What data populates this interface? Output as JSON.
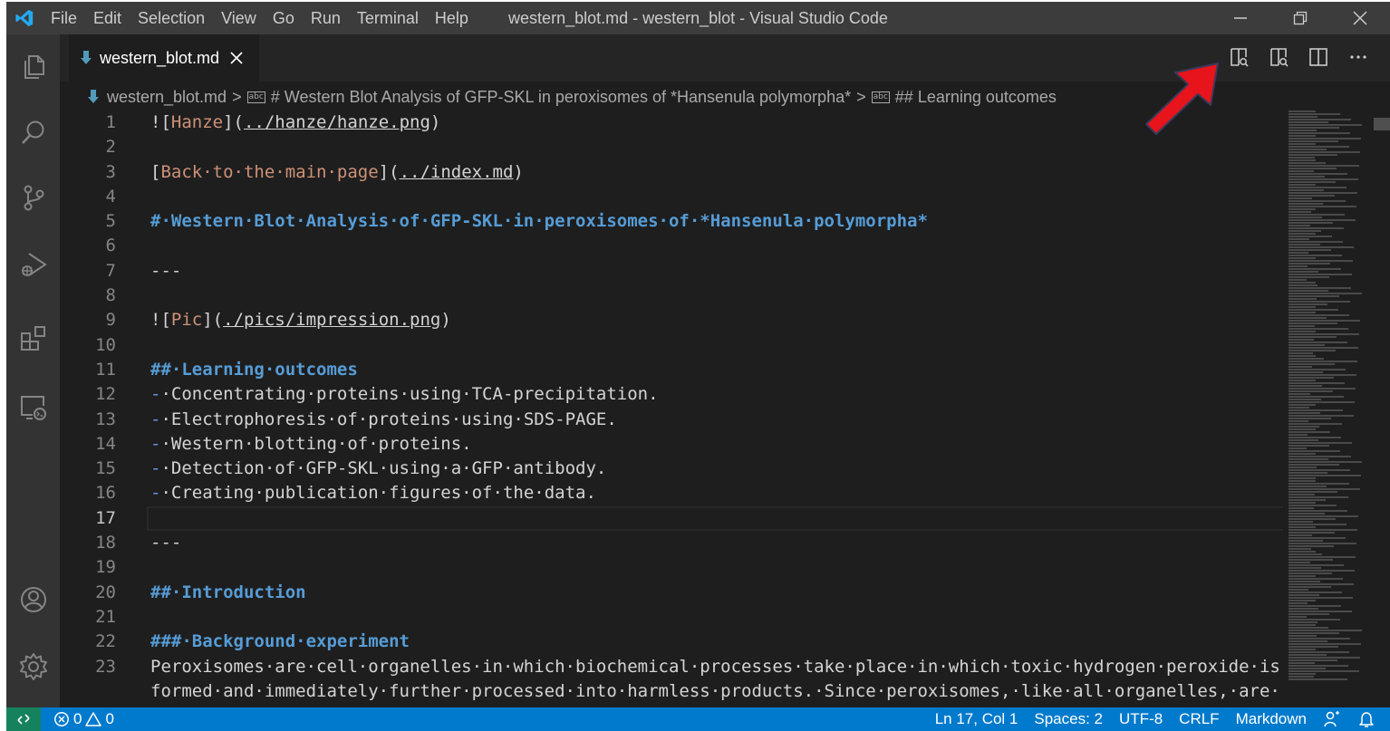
{
  "window": {
    "title": "western_blot.md - western_blot - Visual Studio Code",
    "menu": [
      "File",
      "Edit",
      "Selection",
      "View",
      "Go",
      "Run",
      "Terminal",
      "Help"
    ]
  },
  "tab": {
    "label": "western_blot.md"
  },
  "breadcrumb": {
    "file": "western_blot.md",
    "section1": "# Western Blot Analysis of GFP-SKL in peroxisomes of *Hansenula polymorpha*",
    "section2": "## Learning outcomes"
  },
  "lines": [
    {
      "n": "1",
      "segs": [
        {
          "c": "t",
          "v": "!["
        },
        {
          "c": "lnk",
          "v": "Hanze"
        },
        {
          "c": "t",
          "v": "]("
        },
        {
          "c": "url",
          "v": "../hanze/hanze.png"
        },
        {
          "c": "t",
          "v": ")"
        }
      ]
    },
    {
      "n": "2",
      "segs": []
    },
    {
      "n": "3",
      "segs": [
        {
          "c": "t",
          "v": "["
        },
        {
          "c": "lnk",
          "v": "Back·to·the·main·page"
        },
        {
          "c": "t",
          "v": "]("
        },
        {
          "c": "url",
          "v": "../index.md"
        },
        {
          "c": "t",
          "v": ")"
        }
      ]
    },
    {
      "n": "4",
      "segs": []
    },
    {
      "n": "5",
      "segs": [
        {
          "c": "h",
          "v": "#·Western·Blot·Analysis·of·GFP-SKL·in·peroxisomes·of·*Hansenula·polymorpha*"
        }
      ]
    },
    {
      "n": "6",
      "segs": []
    },
    {
      "n": "7",
      "segs": [
        {
          "c": "t",
          "v": "---"
        }
      ]
    },
    {
      "n": "8",
      "segs": []
    },
    {
      "n": "9",
      "segs": [
        {
          "c": "t",
          "v": "!["
        },
        {
          "c": "lnk",
          "v": "Pic"
        },
        {
          "c": "t",
          "v": "]("
        },
        {
          "c": "url",
          "v": "./pics/impression.png"
        },
        {
          "c": "t",
          "v": ")"
        }
      ]
    },
    {
      "n": "10",
      "segs": []
    },
    {
      "n": "11",
      "segs": [
        {
          "c": "h",
          "v": "##·Learning·outcomes"
        }
      ]
    },
    {
      "n": "12",
      "segs": [
        {
          "c": "dash",
          "v": "-"
        },
        {
          "c": "t",
          "v": "·Concentrating·proteins·using·TCA-precipitation."
        }
      ]
    },
    {
      "n": "13",
      "segs": [
        {
          "c": "dash",
          "v": "-"
        },
        {
          "c": "t",
          "v": "·Electrophoresis·of·proteins·using·SDS-PAGE."
        }
      ]
    },
    {
      "n": "14",
      "segs": [
        {
          "c": "dash",
          "v": "-"
        },
        {
          "c": "t",
          "v": "·Western·blotting·of·proteins."
        }
      ]
    },
    {
      "n": "15",
      "segs": [
        {
          "c": "dash",
          "v": "-"
        },
        {
          "c": "t",
          "v": "·Detection·of·GFP-SKL·using·a·GFP·antibody."
        }
      ]
    },
    {
      "n": "16",
      "segs": [
        {
          "c": "dash",
          "v": "-"
        },
        {
          "c": "t",
          "v": "·Creating·publication·figures·of·the·data."
        }
      ]
    },
    {
      "n": "17",
      "segs": [],
      "current": true
    },
    {
      "n": "18",
      "segs": [
        {
          "c": "t",
          "v": "---"
        }
      ]
    },
    {
      "n": "19",
      "segs": []
    },
    {
      "n": "20",
      "segs": [
        {
          "c": "h",
          "v": "##·Introduction"
        }
      ]
    },
    {
      "n": "21",
      "segs": []
    },
    {
      "n": "22",
      "segs": [
        {
          "c": "h",
          "v": "###·Background·experiment"
        }
      ]
    },
    {
      "n": "23",
      "segs": [
        {
          "c": "t",
          "v": "Peroxisomes·are·cell·organelles·in·which·biochemical·processes·take·place·in·which·toxic·hydrogen·peroxide·is·"
        }
      ]
    },
    {
      "n": "",
      "segs": [
        {
          "c": "t",
          "v": "formed·and·immediately·further·processed·into·harmless·products.·Since·peroxisomes,·like·all·organelles,·are·"
        }
      ]
    }
  ],
  "status": {
    "errors": "0",
    "warnings": "0",
    "position": "Ln 17, Col 1",
    "spaces": "Spaces: 2",
    "encoding": "UTF-8",
    "eol": "CRLF",
    "language": "Markdown"
  },
  "colors": {
    "accent": "#007acc",
    "annotation_arrow": "#e8141b"
  }
}
